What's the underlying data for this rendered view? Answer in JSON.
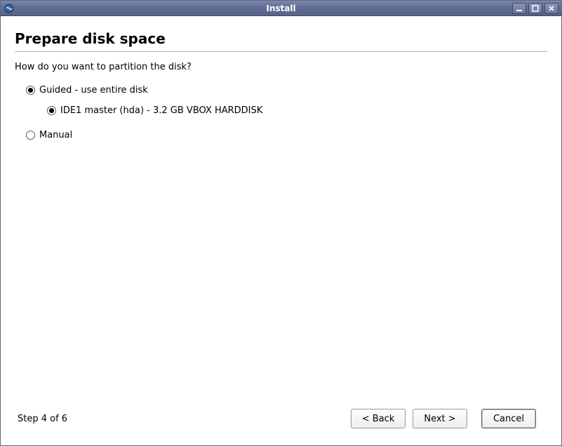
{
  "window": {
    "title": "Install"
  },
  "page": {
    "heading": "Prepare disk space",
    "question": "How do you want to partition the disk?"
  },
  "options": {
    "guided": {
      "label": "Guided - use entire disk",
      "selected": true,
      "disk": {
        "label": "IDE1 master (hda) - 3.2 GB VBOX HARDDISK",
        "selected": true
      }
    },
    "manual": {
      "label": "Manual",
      "selected": false
    }
  },
  "footer": {
    "step": "Step 4 of 6",
    "back": "< Back",
    "next": "Next >",
    "cancel": "Cancel"
  }
}
